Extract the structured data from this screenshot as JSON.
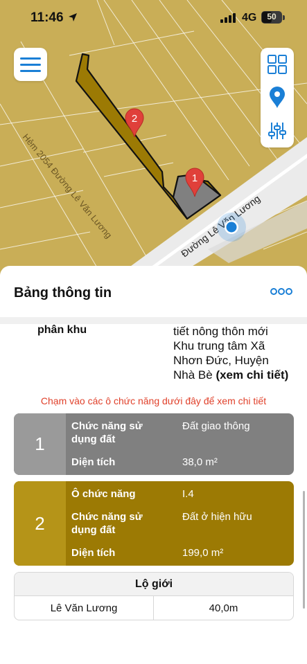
{
  "status_bar": {
    "time": "11:46",
    "network": "4G",
    "battery": "50"
  },
  "map": {
    "street_main": "Đường Lê Văn Lương",
    "street_alley": "Hẻm 2054 Đường Lê Văn Lương",
    "marker_1": "1",
    "marker_2": "2",
    "colors": {
      "land": "#c9ae57",
      "parcel_2": "#9c7a04",
      "parcel_1": "#808080",
      "road": "#ebebeb",
      "marker": "#e0403a",
      "accent": "#1a7fd6"
    }
  },
  "toolbar": {
    "menu_icon": "hamburger-menu-icon",
    "grid_icon": "grid-icon",
    "location_icon": "location-pin-icon",
    "filter_icon": "sliders-icon"
  },
  "panel": {
    "title": "Bảng thông tin",
    "more_icon": "more-dots-icon",
    "zone_label": "phân khu",
    "zone_value_line1": "tiết nông thôn mới",
    "zone_value_line2": "Khu trung tâm Xã",
    "zone_value_line3": "Nhơn Đức, Huyện",
    "zone_value_line4": "Nhà Bè",
    "zone_link": "(xem chi tiết)",
    "hint": "Chạm vào các ô chức năng dưới đây để xem chi tiết"
  },
  "cards": [
    {
      "number": "1",
      "function_label_1": "Chức năng sử",
      "function_label_2": "dụng đất",
      "function_value": "Đất giao thông",
      "area_label": "Diện tích",
      "area_value": "38,0 m²"
    },
    {
      "number": "2",
      "cell_label": "Ô chức năng",
      "cell_value": "I.4",
      "function_label_1": "Chức năng sử",
      "function_label_2": "dụng đất",
      "function_value": "Đất ở hiện hữu",
      "area_label": "Diện tích",
      "area_value": "199,0 m²"
    }
  ],
  "lo_gioi": {
    "header": "Lộ giới",
    "street": "Lê Văn Lương",
    "width": "40,0m"
  }
}
